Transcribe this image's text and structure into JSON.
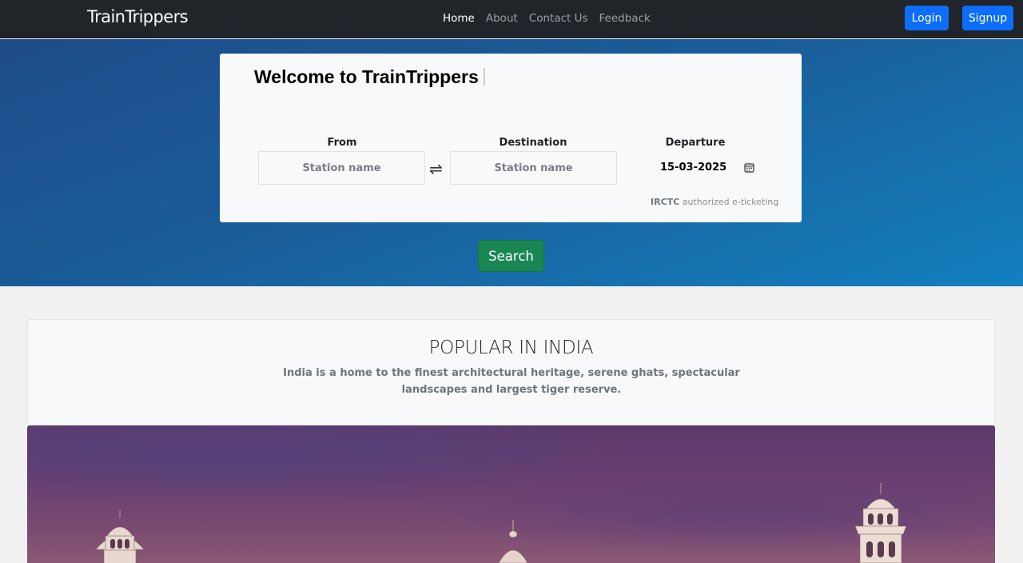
{
  "navbar": {
    "brand": "TrainTrippers",
    "links": [
      "Home",
      "About",
      "Contact Us",
      "Feedback"
    ],
    "login_label": "Login",
    "signup_label": "Signup"
  },
  "search_card": {
    "welcome": "Welcome to TrainTrippers",
    "from_label": "From",
    "from_placeholder": "Station name",
    "destination_label": "Destination",
    "destination_placeholder": "Station name",
    "swap_glyph": "⇌",
    "departure_label": "Departure",
    "departure_date": "15-03-2025",
    "irctc_bold": "IRCTC",
    "irctc_rest": " authorized e-ticketing"
  },
  "search_button": "Search",
  "popular": {
    "title": "POPULAR IN INDIA",
    "description": "India is a home to the finest architectural heritage, serene ghats, spectacular landscapes and largest tiger reserve."
  },
  "colors": {
    "navbar_bg": "#212529",
    "primary": "#0d6efd",
    "success": "#198754"
  }
}
